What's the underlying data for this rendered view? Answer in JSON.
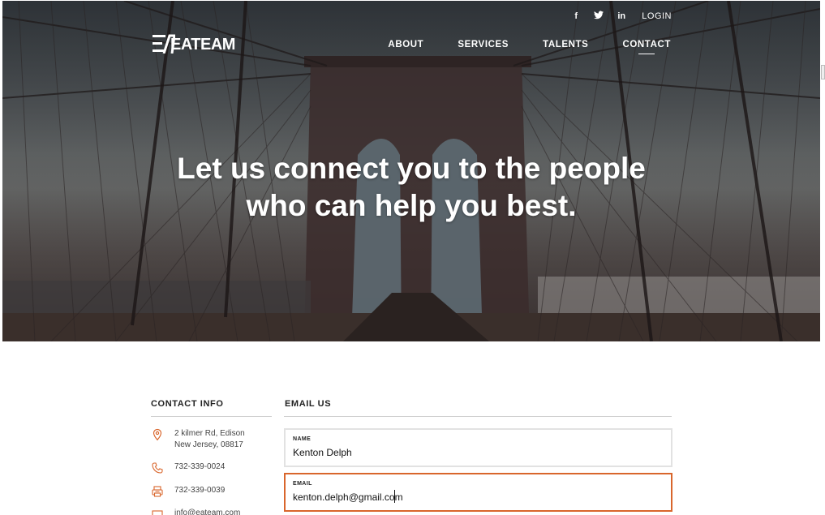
{
  "header": {
    "logo_text": "EATEAM",
    "social": [
      {
        "icon": "facebook-icon",
        "glyph": "f"
      },
      {
        "icon": "twitter-icon",
        "glyph": "t"
      },
      {
        "icon": "linkedin-icon",
        "glyph": "in"
      }
    ],
    "login_label": "LOGIN",
    "nav": [
      {
        "label": "ABOUT",
        "active": false
      },
      {
        "label": "SERVICES",
        "active": false
      },
      {
        "label": "TALENTS",
        "active": false
      },
      {
        "label": "CONTACT",
        "active": true
      }
    ]
  },
  "hero": {
    "line1": "Let us connect you to the people",
    "line2": "who can help you best."
  },
  "contact_info": {
    "title": "CONTACT INFO",
    "address_line1": "2 kilmer Rd, Edison",
    "address_line2": "New Jersey, 08817",
    "phone": "732-339-0024",
    "fax": "732-339-0039",
    "email": "info@eateam.com"
  },
  "email_us": {
    "title": "EMAIL US",
    "name_label": "NAME",
    "name_value": "Kenton Delph",
    "email_label": "EMAIL",
    "email_value": "kenton.delph@gmail.com"
  },
  "colors": {
    "accent": "#d9662c",
    "field_border": "#e2e2e2"
  }
}
